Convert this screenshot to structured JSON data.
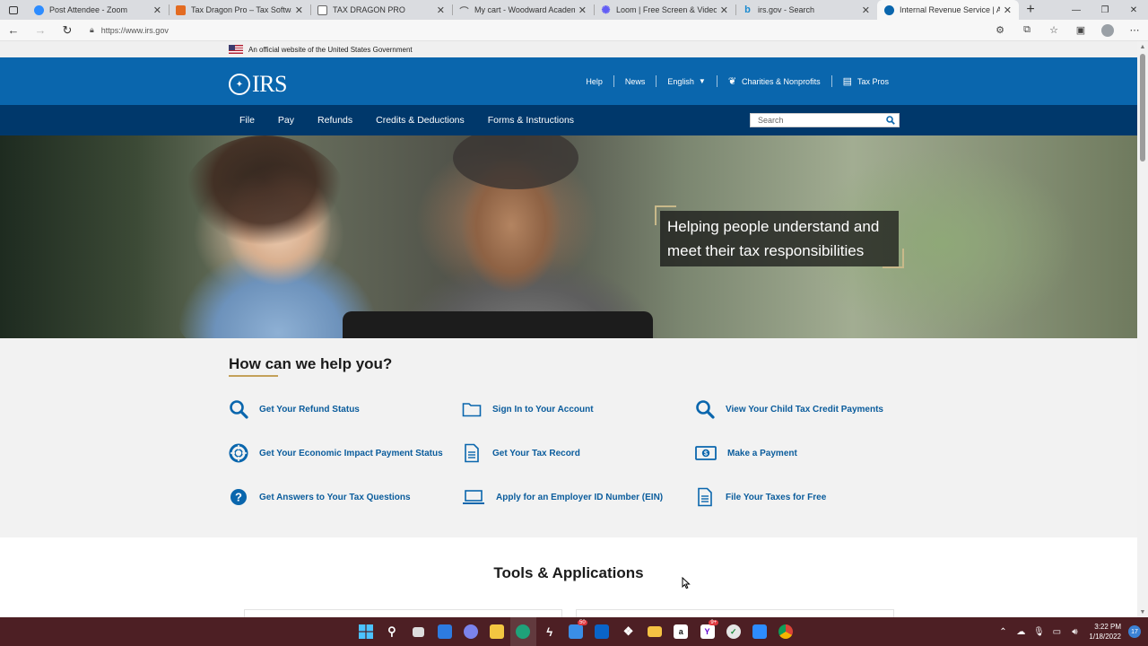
{
  "browser": {
    "tabs": [
      {
        "title": "Post Attendee - Zoom",
        "icon": "zoom-icon",
        "color": "#2d8cff",
        "active": false
      },
      {
        "title": "Tax Dragon Pro – Tax Software for",
        "icon": "tax-dragon-icon",
        "color": "#e36b21",
        "active": false
      },
      {
        "title": "TAX DRAGON PRO",
        "icon": "document-icon",
        "color": "#777777",
        "active": false
      },
      {
        "title": "My cart - Woodward Academy",
        "icon": "cart-icon",
        "color": "#777777",
        "active": false
      },
      {
        "title": "Loom | Free Screen & Video Rec",
        "icon": "loom-icon",
        "color": "#625df5",
        "active": false
      },
      {
        "title": "irs.gov - Search",
        "icon": "bing-icon",
        "color": "#1a8ad0",
        "active": false
      },
      {
        "title": "Internal Revenue Service | An off",
        "icon": "irs-icon",
        "color": "#0a66ad",
        "active": true
      }
    ],
    "url": "https://www.irs.gov"
  },
  "site": {
    "gov_banner": "An official website of the United States Government",
    "logo_text": "IRS",
    "util_nav": {
      "help": "Help",
      "news": "News",
      "language": "English",
      "charities": "Charities & Nonprofits",
      "tax_pros": "Tax Pros"
    },
    "main_nav": [
      "File",
      "Pay",
      "Refunds",
      "Credits & Deductions",
      "Forms & Instructions"
    ],
    "search_placeholder": "Search",
    "hero_text": "Helping people understand and meet their tax responsibilities",
    "help_title": "How can we help you?",
    "help_links": [
      {
        "label": "Get Your Refund Status",
        "icon": "search-icon"
      },
      {
        "label": "Sign In to Your Account",
        "icon": "folder-icon"
      },
      {
        "label": "View Your Child Tax Credit Payments",
        "icon": "search-icon"
      },
      {
        "label": "Get Your Economic Impact Payment Status",
        "icon": "lifebuoy-icon"
      },
      {
        "label": "Get Your Tax Record",
        "icon": "document-icon"
      },
      {
        "label": "Make a Payment",
        "icon": "money-icon"
      },
      {
        "label": "Get Answers to Your Tax Questions",
        "icon": "question-icon"
      },
      {
        "label": "Apply for an Employer ID Number (EIN)",
        "icon": "laptop-icon"
      },
      {
        "label": "File Your Taxes for Free",
        "icon": "document-icon"
      }
    ],
    "tools_title": "Tools & Applications"
  },
  "taskbar": {
    "time": "3:22 PM",
    "date": "1/18/2022",
    "mail_badge": "50",
    "yahoo_badge": "9+",
    "notifications": "17"
  },
  "colors": {
    "header_blue": "#0a66ad",
    "nav_dark_blue": "#00386b",
    "link_blue": "#0a5c9c",
    "accent_gold": "#c4a15a"
  }
}
